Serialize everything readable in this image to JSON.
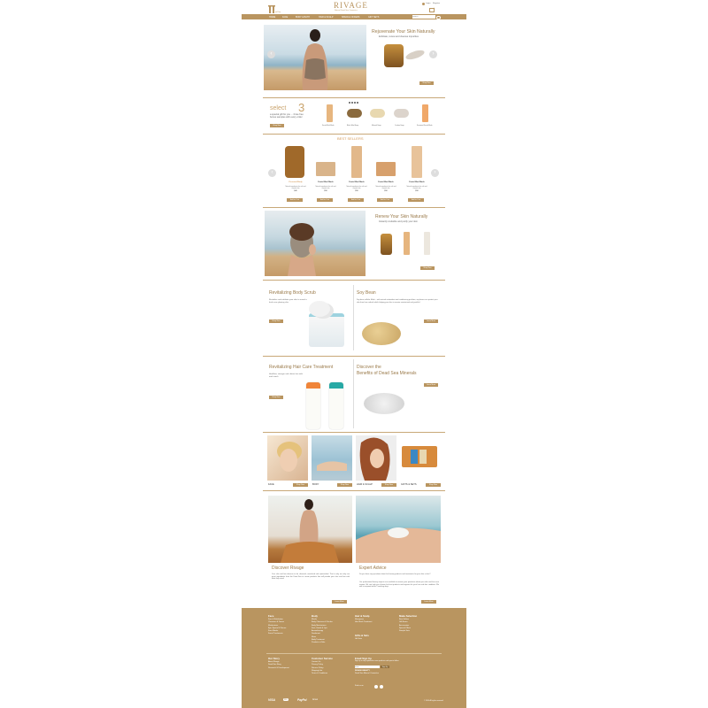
{
  "header": {
    "brand": "RIVAGE",
    "tagline": "Natural Dead Sea Cosmetics",
    "account": [
      "Login",
      "Register"
    ],
    "cart_count": "0",
    "search_placeholder": "Search"
  },
  "nav": [
    "HOME",
    "FACE",
    "BODY & BATH",
    "HAIR & SCALP",
    "SPECIAL OFFERS",
    "GIFT SETS"
  ],
  "hero": {
    "title": "Rejuvenate Your Skin Naturally",
    "text": "Exfoliate, renew and cleanse impurities",
    "button": "Shop Now"
  },
  "select3": {
    "title_word": "select",
    "title_num": "3",
    "text": "a special gift for you ... three free bonus samples with every order",
    "button": "Shop Now",
    "items": [
      "Facial Mud Mask",
      "Black Mud Soap",
      "Mineral Soap",
      "Carbon Soap",
      "Seaweed Facial Mask"
    ]
  },
  "best_sellers": {
    "title": "BEST SELLERS",
    "products": [
      {
        "name": "Personal Body",
        "price": "$46",
        "desc": "Natural ingredients for soft and smooth skin",
        "button": "Add to Cart",
        "color": "#a0692a"
      },
      {
        "name": "Facial Mud Mask",
        "price": "$58",
        "desc": "Natural ingredients for soft and smooth skin",
        "button": "Add to Cart",
        "color": "#d9b48a"
      },
      {
        "name": "Facial Mud Mask",
        "price": "$58",
        "desc": "Natural ingredients for soft and smooth skin",
        "button": "Add to Cart",
        "color": "#e2b88a"
      },
      {
        "name": "Facial Mud Mask",
        "price": "$58",
        "desc": "Natural ingredients for soft and smooth skin",
        "button": "Add to Cart",
        "color": "#d7a06c"
      },
      {
        "name": "Facial Mud Mask",
        "price": "$58",
        "desc": "Natural ingredients for soft and smooth skin",
        "button": "Add to Cart",
        "color": "#e8c39a"
      }
    ]
  },
  "renew": {
    "title": "Renew Your Skin Naturally",
    "text": "Instantly revitalize and purify your skin",
    "button": "Shop Now"
  },
  "promo_row1": [
    {
      "title": "Revitalizing Body Scrub",
      "text": "Revitalize and exfoliate your skin to reveal a fresh new glowing skin",
      "button": "Shop Now"
    },
    {
      "title": "Soy Bean",
      "text": "Soy bean cellular Mask – with natural antioxidant and conditioning qualities, soy beans can protect your skin from free radicals while helping your skin to remain moisturized and youthful.",
      "button": "Learn More"
    }
  ],
  "promo_row2": [
    {
      "title": "Revitalizing Hair Care Treatment",
      "text": "Healthier, stronger and shinier hair with each wash",
      "button": "Shop Now"
    },
    {
      "title_line1": "Discover the",
      "title_line2": "Benefits of Dead Sea Minerals",
      "button": "Learn More"
    }
  ],
  "categories": [
    {
      "label": "FACE",
      "button": "Shop Now"
    },
    {
      "label": "BODY",
      "button": "Shop Now"
    },
    {
      "label": "HAIR & SCALP",
      "button": "Shop Now"
    },
    {
      "label": "GIFTS & SETS",
      "button": "Shop Now"
    }
  ],
  "discover": {
    "title": "Discover Rivage",
    "text": "Your skin and hair deserve to be cleansed, nourished and replenished. That is why we only use great ingredients from the Dead Sea to create products that will provide your skin and hair with what they need.",
    "button": "Learn More"
  },
  "advice": {
    "title": "Expert Advice",
    "text1": "Do you have any questions about the beauty products and treatments for your skin or hair?",
    "text2": "Our professional beauty experts are available to answer your questions about your skin and hair care regime. We can help you choose the best products and regimes for your hair and skin condition. We aim to respond within 2 working days.",
    "button": "Learn More"
  },
  "footer": {
    "cols": [
      {
        "head": "Face",
        "links": [
          "Face & Exfoliation",
          "Cleansers & Toners",
          "Moisturizers",
          "Eye, Special & Serum",
          "Face Masks",
          "Facial Treatments"
        ]
      },
      {
        "head": "Body",
        "links": [
          "Masks",
          "Body Cleansers & Scrubs",
          "Body Moisturizers",
          "Feet, Hands & Lips",
          "Aromatherapy",
          "Deodorant",
          "Mens",
          "Body Treatment",
          "Products at Sale"
        ]
      },
      {
        "head": "Hair & Scalp",
        "links": [
          "Shampoos",
          "Hair Mask Treatment"
        ]
      },
      {
        "head": "Make Selection",
        "links": [
          "Best Sellers",
          "Gift Boxes",
          "Accessories",
          "Special Offers",
          "Sample Sets"
        ]
      }
    ],
    "gifts_head": "Gifts & Sets",
    "gifts_links": [
      "Gift Sets"
    ],
    "story_head": "Our Story",
    "story_links": [
      "About Rivage",
      "Dead Sea Story",
      "Research & Development"
    ],
    "service_head": "Customer Service",
    "service_links": [
      "Contact Us",
      "Privacy Policy",
      "Returns Policy",
      "Shipping Info",
      "Terms & Conditions"
    ],
    "email_head": "Email Sign Up",
    "email_text": "Sign up to stay updated on new products and special offers",
    "email_placeholder": "Email",
    "email_button": "Sign Up",
    "contact_text": "RIVAGE BEAUTY",
    "contact_sub": "Dead Sea Mineral Cosmetics",
    "find_us": "Find us on",
    "payments": [
      "VISA",
      "MC",
      "PayPal",
      "Amex"
    ],
    "copyright": "© 2014 All rights reserved"
  },
  "colors": {
    "gold": "#b99560",
    "title": "#9a7a4a"
  }
}
